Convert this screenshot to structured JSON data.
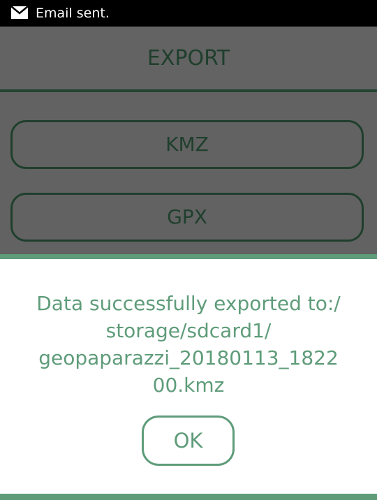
{
  "status_bar": {
    "icon": "mail-icon",
    "text": "Email sent."
  },
  "header": {
    "title": "EXPORT"
  },
  "export_options": [
    {
      "label": "KMZ"
    },
    {
      "label": "GPX"
    }
  ],
  "dialog": {
    "message_lines": [
      "Data successfully exported to:/",
      "storage/sdcard1/",
      "geopaparazzi_20180113_1822",
      "00.kmz"
    ],
    "ok_label": "OK"
  },
  "colors": {
    "accent": "#5f9c7a",
    "dark_green": "#1f3f2d",
    "overlay_gray": "#626262",
    "status_bar": "#000000"
  }
}
